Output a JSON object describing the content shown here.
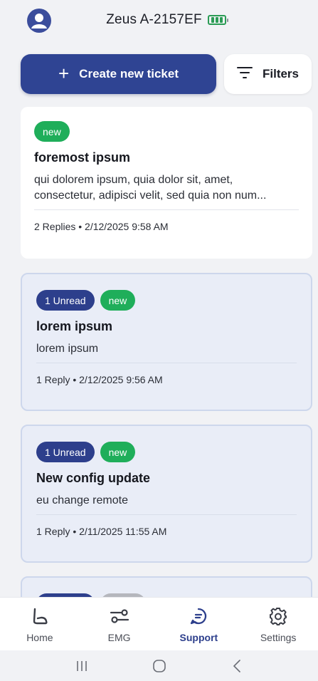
{
  "header": {
    "device_name": "Zeus A-2157EF",
    "battery_icon": "battery-icon",
    "avatar_icon": "user-icon"
  },
  "actions": {
    "create_label": "Create new ticket",
    "filters_label": "Filters"
  },
  "tickets": [
    {
      "badges": [
        {
          "label": "new",
          "kind": "new"
        }
      ],
      "title": "foremost ipsum",
      "body_line1": "qui dolorem ipsum, quia dolor sit, amet,",
      "body_line2": "consectetur, adipisci velit, sed quia non num...",
      "meta": "2  Replies • 2/12/2025 9:58 AM",
      "unread": false
    },
    {
      "badges": [
        {
          "label": "1 Unread",
          "kind": "unread"
        },
        {
          "label": "new",
          "kind": "new"
        }
      ],
      "title": "lorem ipsum",
      "body_line1": "lorem ipsum",
      "meta": "1  Reply • 2/12/2025 9:56 AM",
      "unread": true
    },
    {
      "badges": [
        {
          "label": "1 Unread",
          "kind": "unread"
        },
        {
          "label": "new",
          "kind": "new"
        }
      ],
      "title": "New config update",
      "body_line1": "eu change remote",
      "meta": "1  Reply • 2/11/2025 11:55 AM",
      "unread": true
    }
  ],
  "bottom_nav": [
    {
      "label": "Home",
      "icon": "home-icon",
      "active": false
    },
    {
      "label": "EMG",
      "icon": "emg-icon",
      "active": false
    },
    {
      "label": "Support",
      "icon": "support-chat-icon",
      "active": true
    },
    {
      "label": "Settings",
      "icon": "gear-icon",
      "active": false
    }
  ],
  "colors": {
    "primary": "#2f4493",
    "new_badge": "#1fae5a",
    "unread_badge": "#2d3f8c",
    "battery": "#2b9c55"
  }
}
